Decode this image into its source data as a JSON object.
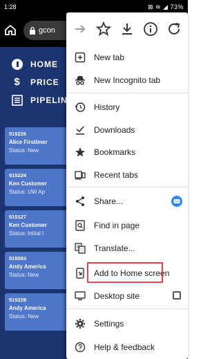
{
  "status_bar": {
    "time": "1:28",
    "icons_text": "⊠ ≋ ◢ 73%",
    "battery": "73%"
  },
  "browser": {
    "url_text": "gcon"
  },
  "app_nav": [
    {
      "label": "HOME",
      "icon": "home-circle-icon"
    },
    {
      "label": "PRICE",
      "icon": "dollar-icon"
    },
    {
      "label": "PIPELIN",
      "icon": "pipeline-icon"
    }
  ],
  "cards": [
    {
      "id": "515226",
      "name": "Alice Firstimer",
      "status": "Status: New"
    },
    {
      "id": "515224",
      "name": "Ken Customer",
      "status": "Status: UW Ap"
    },
    {
      "id": "515127",
      "name": "Ken Customer",
      "status": "Status: Initial I"
    },
    {
      "id": "515093",
      "name": "Andy America",
      "status": "Status: New"
    },
    {
      "id": "515228",
      "name": "Andy America",
      "status": "Status: New"
    }
  ],
  "menu": {
    "toolbar": [
      "forward-arrow-icon",
      "star-icon",
      "download-icon",
      "info-icon",
      "refresh-icon"
    ],
    "items": [
      {
        "label": "New tab",
        "icon": "new-tab-icon"
      },
      {
        "label": "New Incognito tab",
        "icon": "incognito-icon"
      },
      {
        "label": "History",
        "icon": "history-icon"
      },
      {
        "label": "Downloads",
        "icon": "downloads-icon"
      },
      {
        "label": "Bookmarks",
        "icon": "bookmarks-star-icon"
      },
      {
        "label": "Recent tabs",
        "icon": "recent-tabs-icon"
      },
      {
        "label": "Share...",
        "icon": "share-icon"
      },
      {
        "label": "Find in page",
        "icon": "find-in-page-icon"
      },
      {
        "label": "Translate...",
        "icon": "translate-icon"
      },
      {
        "label": "Add to Home screen",
        "icon": "add-to-home-icon"
      },
      {
        "label": "Desktop site",
        "icon": "desktop-icon"
      },
      {
        "label": "Settings",
        "icon": "settings-gear-icon"
      },
      {
        "label": "Help & feedback",
        "icon": "help-icon"
      }
    ]
  },
  "colors": {
    "app_bg": "#1c3570",
    "card_bg": "#4f76c9",
    "highlight": "#e0434a"
  }
}
